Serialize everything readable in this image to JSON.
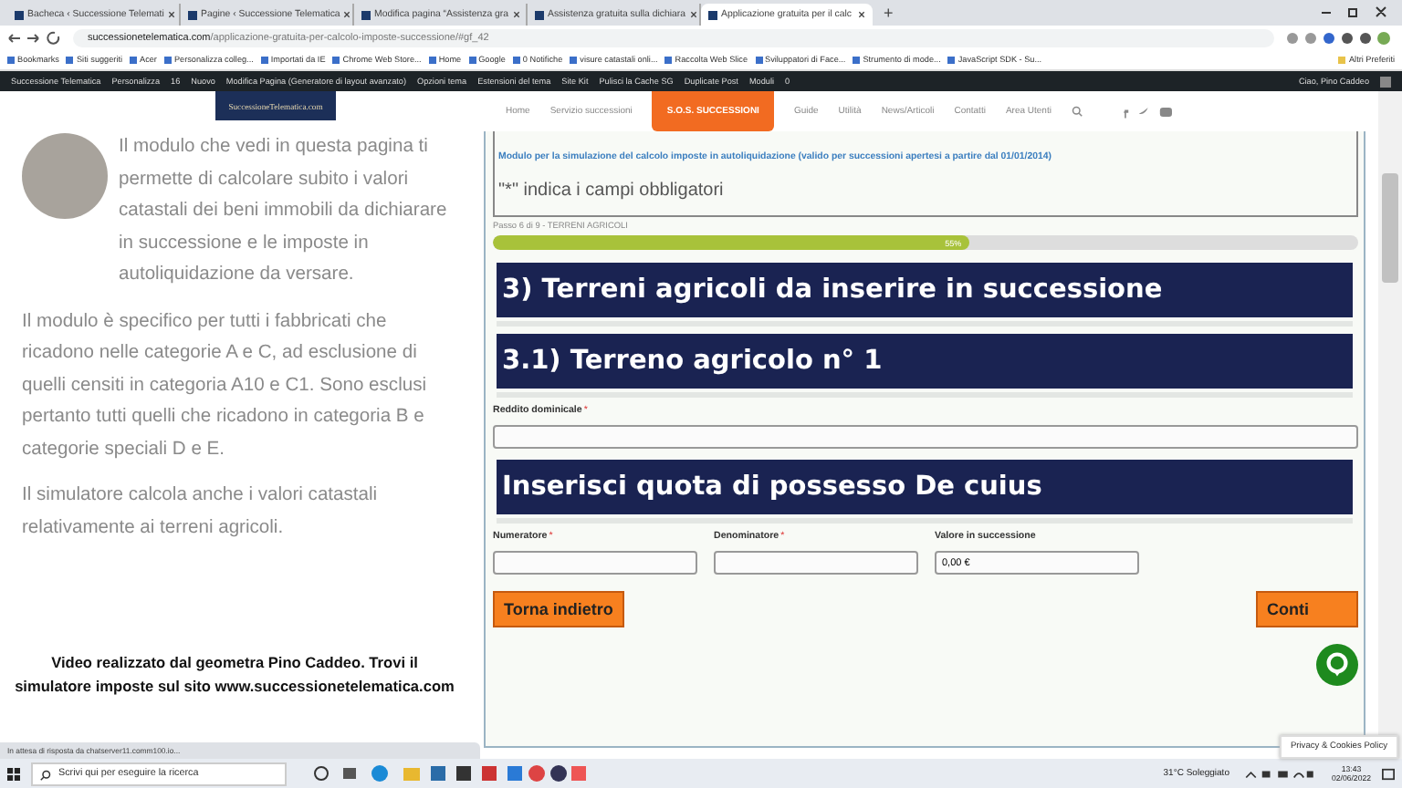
{
  "browser": {
    "tabs": [
      {
        "title": "Bacheca ‹ Successione Telemati",
        "selected": false
      },
      {
        "title": "Pagine ‹ Successione Telematica",
        "selected": false
      },
      {
        "title": "Modifica pagina “Assistenza gra",
        "selected": false
      },
      {
        "title": "Assistenza gratuita sulla dichiara",
        "selected": false
      },
      {
        "title": "Applicazione gratuita per il calc",
        "selected": true
      }
    ],
    "new_tab": "+",
    "url_host": "successionetelematica.com",
    "url_path": "/applicazione-gratuita-per-calcolo-imposte-successione/#gf_42",
    "bookmarks": [
      "Bookmarks",
      "Siti suggeriti",
      "Acer",
      "Personalizza colleg...",
      "Importati da IE",
      "Chrome Web Store...",
      "Home",
      "Google",
      "0 Notifiche",
      "visure catastali onli...",
      "Raccolta Web Slice",
      "Sviluppatori di Face...",
      "Strumento di mode...",
      "JavaScript SDK - Su..."
    ],
    "other_bookmarks": "Altri Preferiti"
  },
  "admin_bar": {
    "items": [
      "Successione Telematica",
      "Personalizza",
      "16",
      "Nuovo",
      "Modifica Pagina (Generatore di layout avanzato)",
      "Opzioni tema",
      "Estensioni del tema",
      "Site Kit",
      "Pulisci la Cache SG",
      "Duplicate Post",
      "Moduli",
      "0"
    ],
    "greeting": "Ciao, Pino Caddeo"
  },
  "left_panel": {
    "logo": "SuccessioneTelematica.com",
    "paragraphs": [
      "Il modulo che vedi in questa pagina ti permette di calcolare subito i valori catastali dei beni immobili da dichiarare in successione e le imposte in autoliquidazione da versare.",
      "Il modulo è specifico per tutti i fabbricati che ricadono nelle categorie A e C, ad esclusione di quelli censiti in categoria A10 e C1. Sono esclusi pertanto tutti quelli che ricadono in categoria B e categorie speciali D e E.",
      "Il simulatore calcola anche i valori catastali relativamente ai terreni agricoli."
    ],
    "caption": "Video realizzato dal geometra Pino Caddeo. Trovi il simulatore imposte sul sito www.successionetelematica.com"
  },
  "site_nav": [
    {
      "label": "Home",
      "selected": false
    },
    {
      "label": "Servizio successioni",
      "selected": false
    },
    {
      "label": "S.O.S. SUCCESSIONI",
      "selected": true
    },
    {
      "label": "Guide",
      "selected": false
    },
    {
      "label": "Utilità",
      "selected": false
    },
    {
      "label": "News/Articoli",
      "selected": false
    },
    {
      "label": "Contatti",
      "selected": false
    },
    {
      "label": "Area Utenti",
      "selected": false
    }
  ],
  "form": {
    "intro": "Modulo per la simulazione del calcolo imposte in autoliquidazione (valido per successioni apertesi a partire dal 01/01/2014)",
    "required_note": "\"*\" indica i campi obbligatori",
    "step": "Passo 6 di 9 - TERRENI AGRICOLI",
    "progress": {
      "level": 0.55,
      "label": "55%"
    },
    "sections": [
      {
        "kind": "heading",
        "text": "3) Terreni agricoli da inserire in successione"
      },
      {
        "kind": "heading",
        "text": "3.1) Terreno agricolo n° 1"
      },
      {
        "kind": "fields",
        "fields": [
          {
            "label": "Reddito dominicale",
            "required_mark": "*"
          }
        ]
      },
      {
        "kind": "heading",
        "text": "Inserisci quota di possesso De cuius"
      },
      {
        "kind": "fields",
        "fields": [
          {
            "label": "Numeratore",
            "required_mark": "*"
          },
          {
            "label": "Denominatore",
            "required_mark": "*"
          },
          {
            "label": "Valore in successione",
            "value": "0,00 €"
          }
        ]
      }
    ],
    "back_button": "Torna indietro",
    "next_button": "Conti"
  },
  "privacy": "Privacy & Cookies Policy",
  "status_text": "In attesa di risposta da chatserver11.comm100.io...",
  "taskbar": {
    "search_placeholder": "Scrivi qui per eseguire la ricerca",
    "weather": "31°C Soleggiato",
    "time": "13:43",
    "date": "02/06/2022"
  }
}
